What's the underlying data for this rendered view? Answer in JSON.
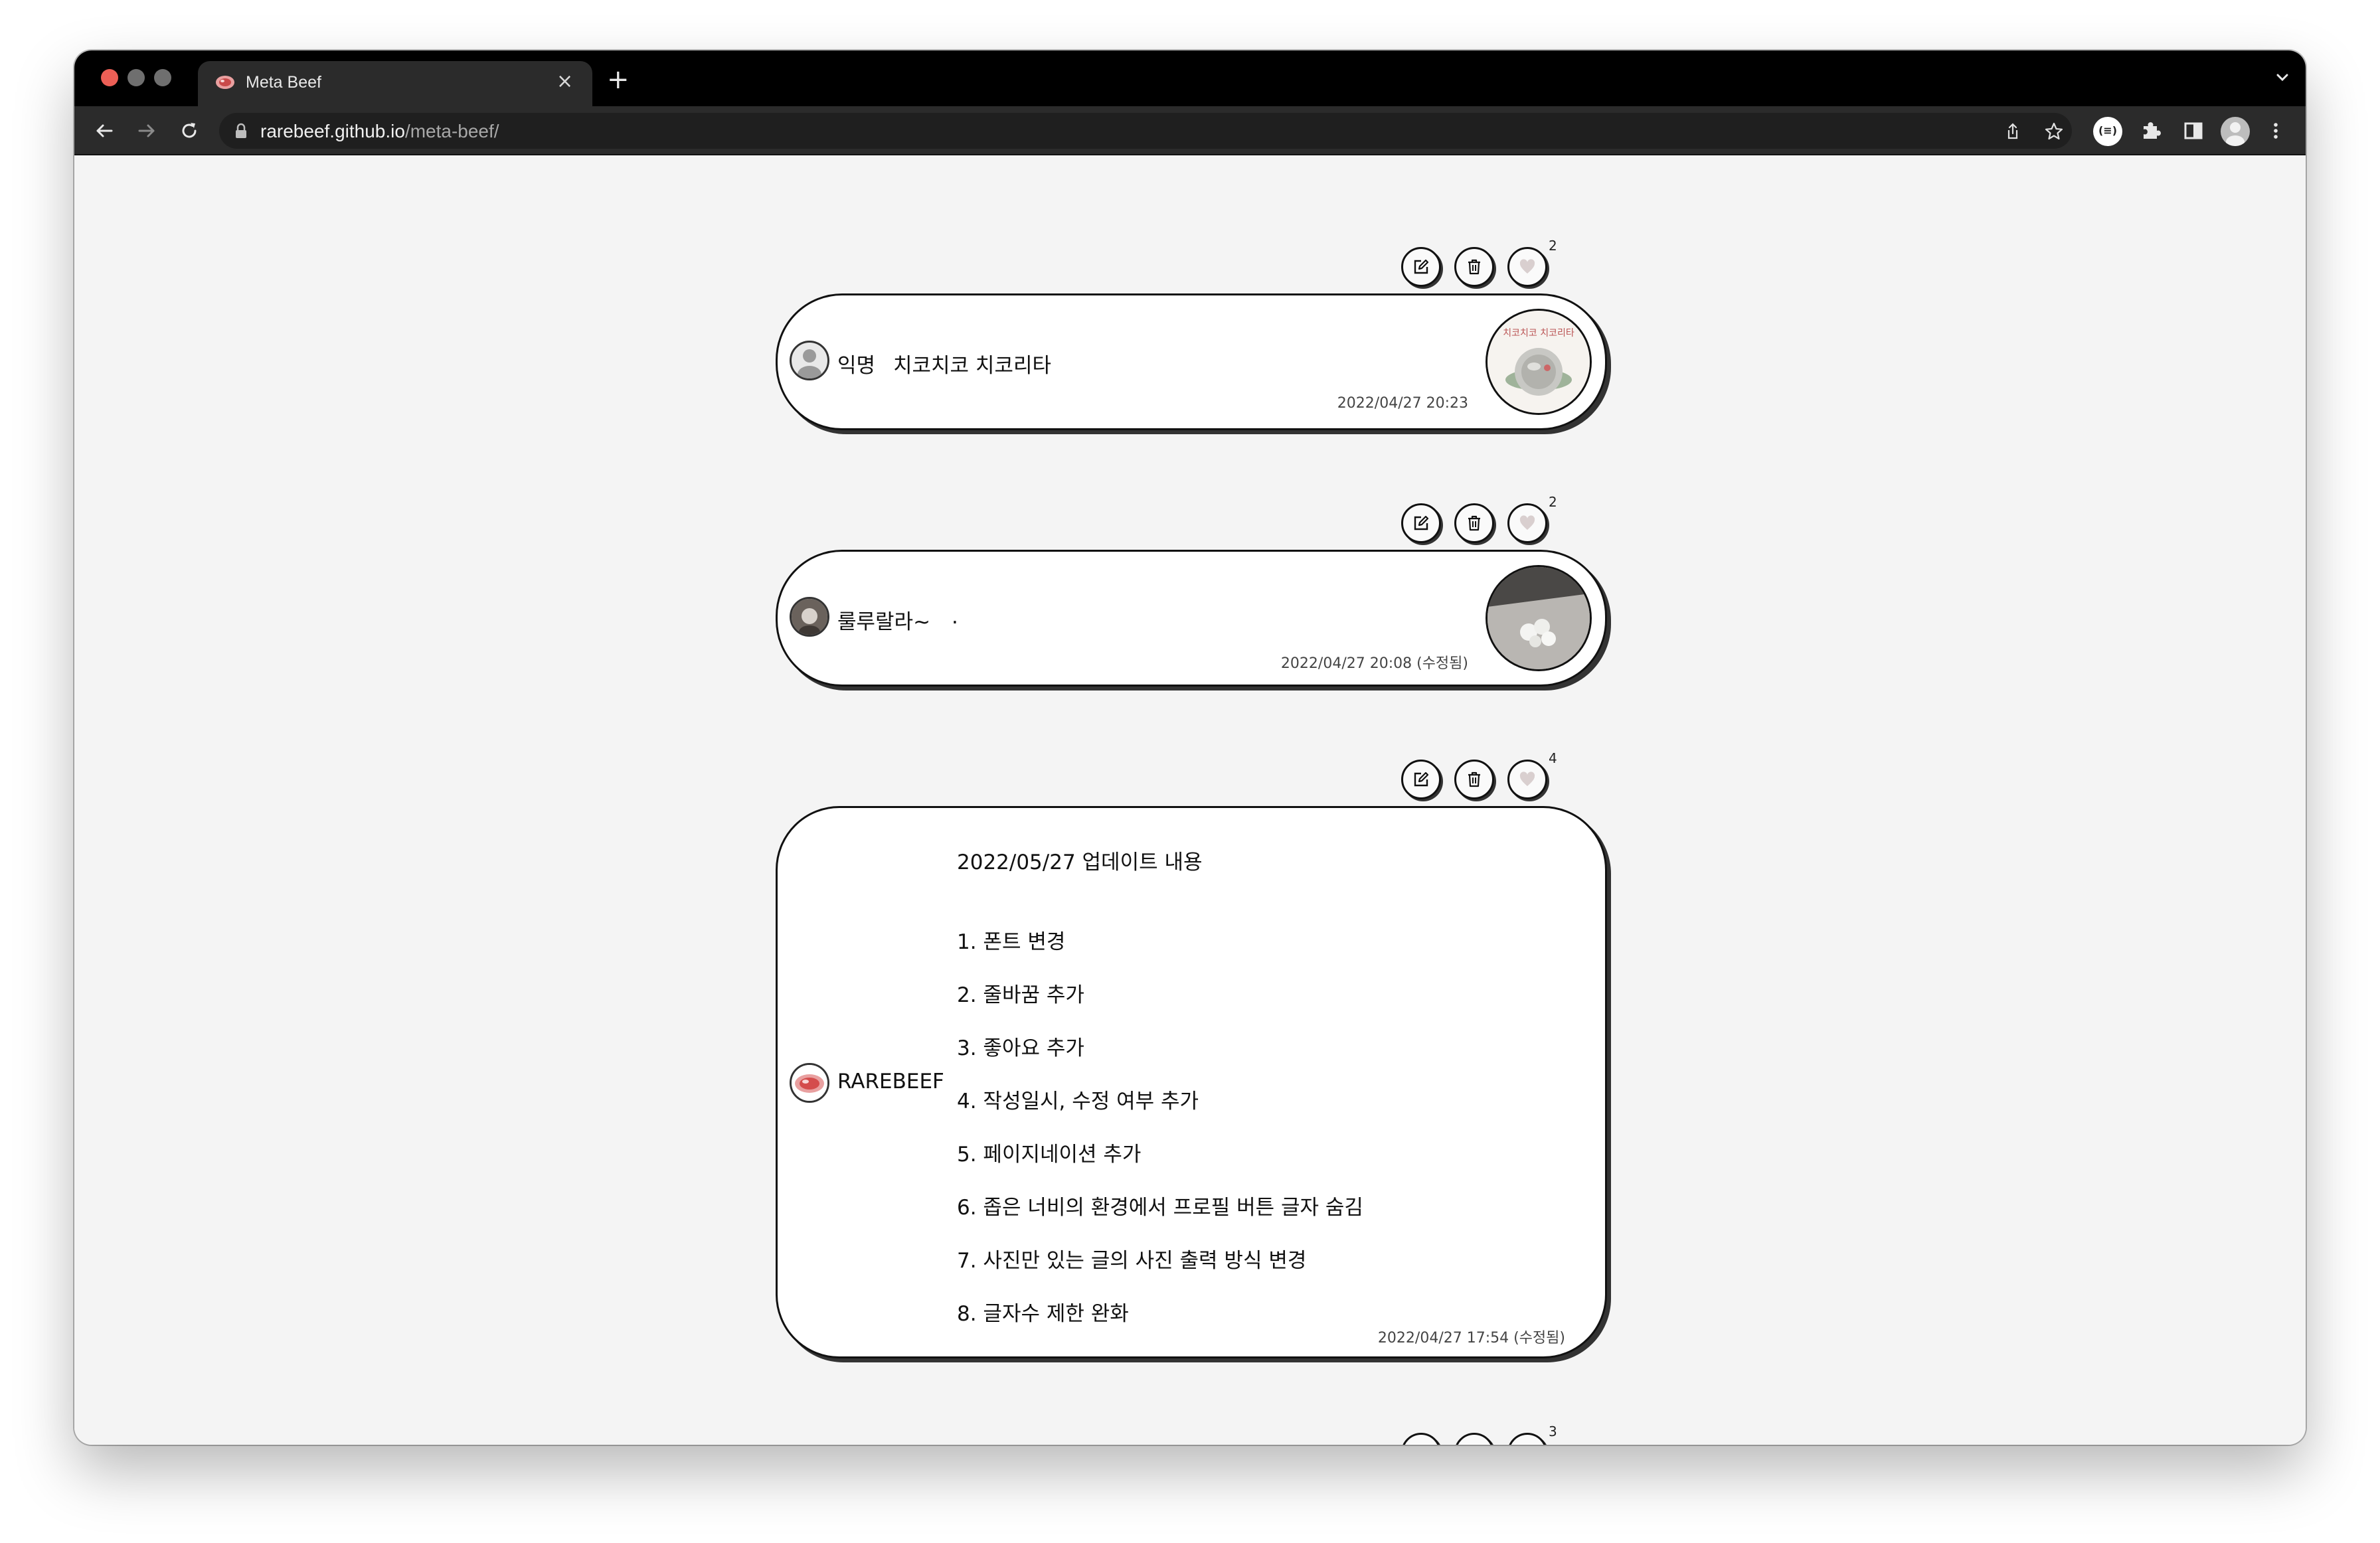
{
  "browser": {
    "tab_title": "Meta Beef",
    "tab_close": "×",
    "new_tab": "+",
    "url_host": "rarebeef.github.io",
    "url_path": "/meta-beef/",
    "extension_badge": "(≡)"
  },
  "posts": [
    {
      "like_count": "2",
      "author": "익명",
      "text": "치코치코 치코리타",
      "date": "2022/04/27 20:23",
      "thumbnail_caption": "치코치코 치코리타"
    },
    {
      "like_count": "2",
      "author": "룰루랄라~",
      "text": ".",
      "date": "2022/04/27 20:08 (수정됨)"
    },
    {
      "like_count": "4",
      "author": "RAREBEEF",
      "title": "2022/05/27 업데이트 내용",
      "items": [
        "1. 폰트 변경",
        "2. 줄바꿈 추가",
        "3. 좋아요 추가",
        "4. 작성일시, 수정 여부 추가",
        "5. 페이지네이션 추가",
        "6. 좁은 너비의 환경에서 프로필 버튼 글자 숨김",
        "7. 사진만 있는 글의 사진 출력 방식 변경",
        "8. 글자수 제한 완화"
      ],
      "date": "2022/04/27 17:54 (수정됨)"
    },
    {
      "like_count": "3"
    }
  ],
  "colors": {
    "tab_bar": "#000000",
    "toolbar": "#2b2b2b",
    "page_bg": "#f4f4f4",
    "close_dot": "#ec5f56",
    "like_heart": "#d9cfcf"
  }
}
